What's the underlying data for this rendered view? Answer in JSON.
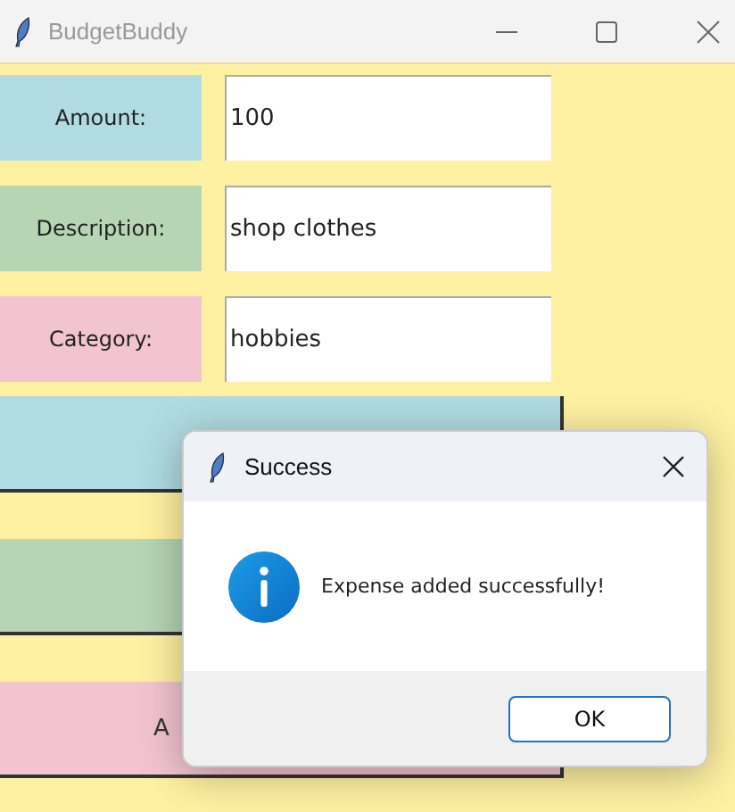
{
  "window": {
    "title": "BudgetBuddy"
  },
  "fields": [
    {
      "label": "Amount:",
      "value": "100",
      "color": "#b0dbe2"
    },
    {
      "label": "Description:",
      "value": "shop clothes",
      "color": "#b5d5b3"
    },
    {
      "label": "Category:",
      "value": "hobbies",
      "color": "#f2c4d0"
    }
  ],
  "buttons": [
    {
      "color": "#b0dbe2"
    },
    {
      "color": "#b5d5b3"
    },
    {
      "label": "A",
      "color": "#f2c4d0"
    }
  ],
  "dialog": {
    "title": "Success",
    "message": "Expense added successfully!",
    "ok": "OK"
  }
}
